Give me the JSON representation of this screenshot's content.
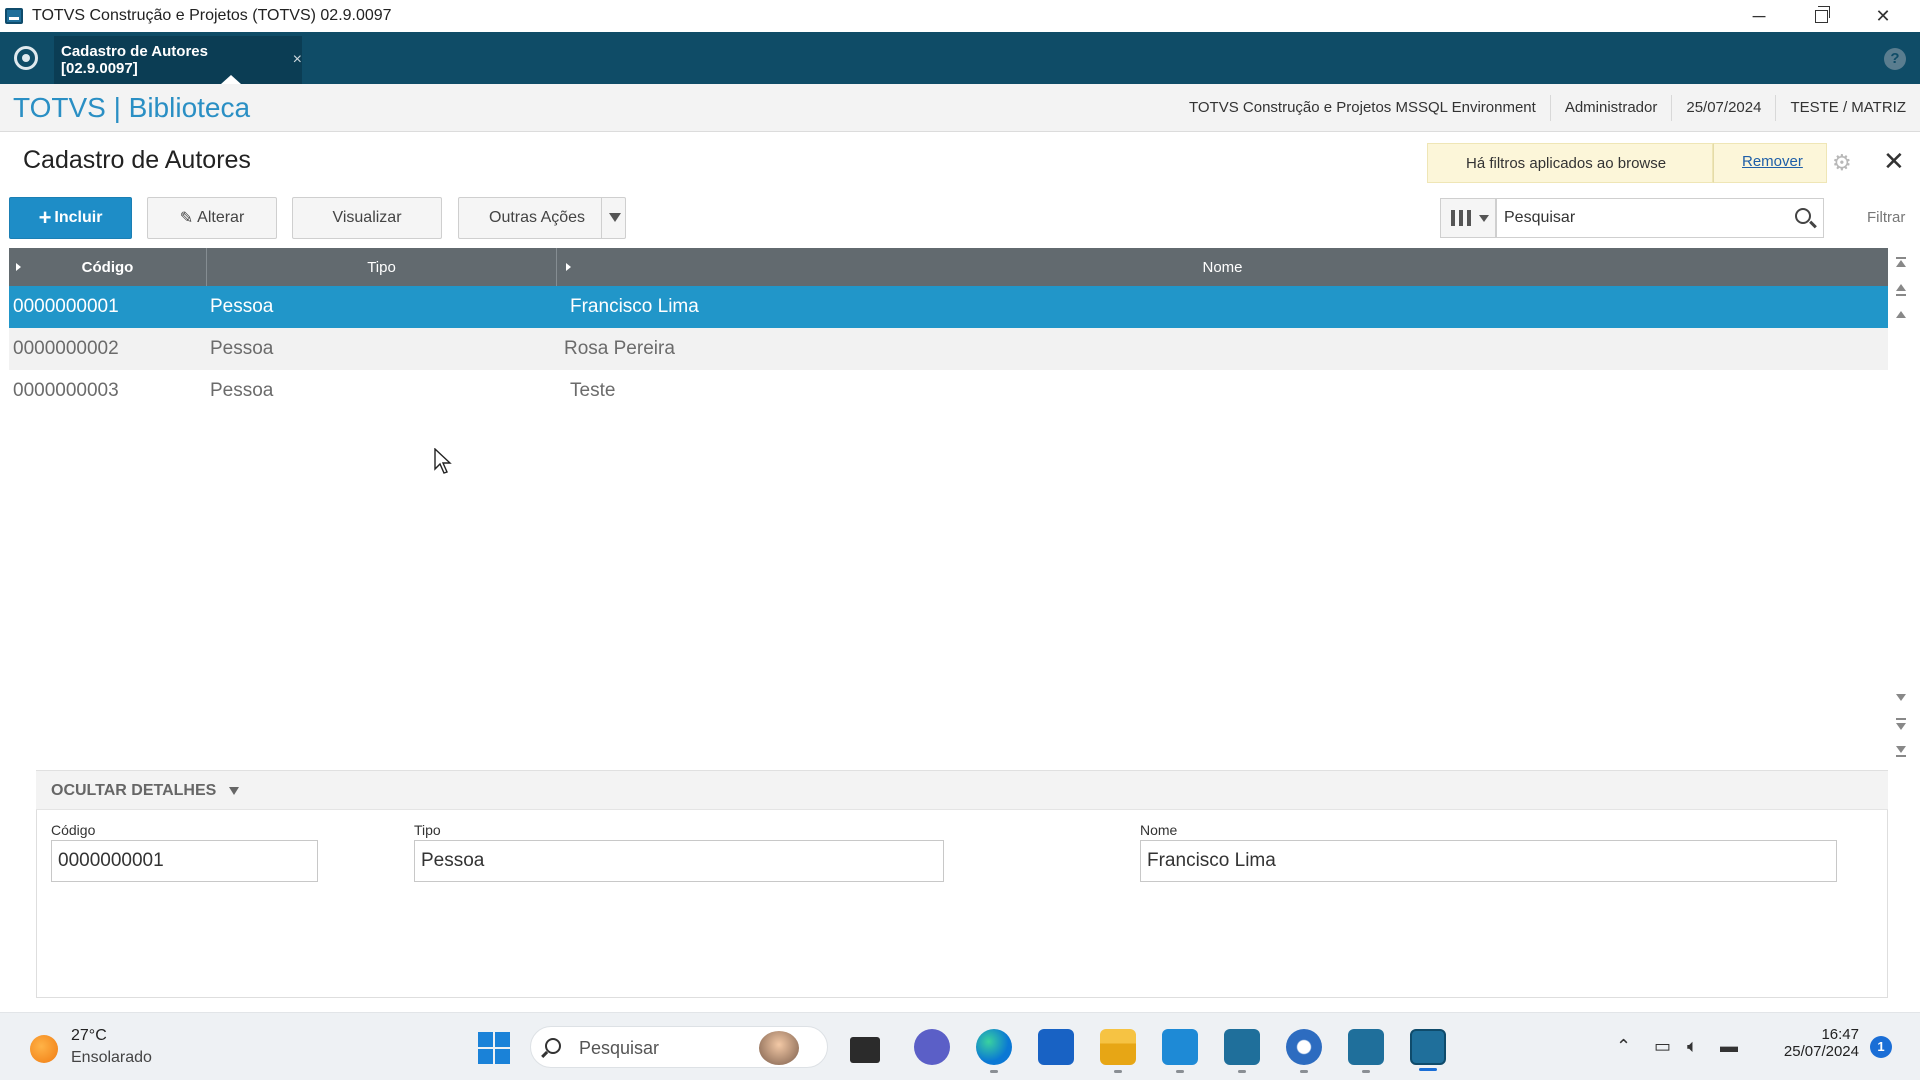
{
  "window": {
    "title": "TOTVS Construção e Projetos (TOTVS) 02.9.0097",
    "minimize": "─",
    "close": "✕"
  },
  "tabbar": {
    "active_tab": "Cadastro de Autores [02.9.0097]",
    "tab_close": "×",
    "help": "?"
  },
  "header": {
    "brand": "TOTVS | Biblioteca",
    "environment": "TOTVS Construção e Projetos MSSQL Environment",
    "user": "Administrador",
    "date": "25/07/2024",
    "company": "TESTE / MATRIZ"
  },
  "page": {
    "title": "Cadastro de Autores",
    "filter_notice": "Há filtros aplicados ao browse",
    "remove_link": "Remover",
    "close": "✕"
  },
  "toolbar": {
    "incluir": "Incluir",
    "alterar": "Alterar",
    "visualizar": "Visualizar",
    "outras_acoes": "Outras Ações",
    "search_placeholder": "Pesquisar",
    "filtrar": "Filtrar"
  },
  "grid": {
    "columns": [
      "Código",
      "Tipo",
      "Nome"
    ],
    "rows": [
      {
        "codigo": "0000000001",
        "tipo": "Pessoa",
        "nome": "Francisco Lima",
        "selected": true
      },
      {
        "codigo": "0000000002",
        "tipo": "Pessoa",
        "nome": "Rosa Pereira",
        "selected": false
      },
      {
        "codigo": "0000000003",
        "tipo": "Pessoa",
        "nome": "Teste",
        "selected": false
      }
    ]
  },
  "details": {
    "toggle_label": "OCULTAR DETALHES",
    "codigo_label": "Código",
    "codigo_value": "0000000001",
    "tipo_label": "Tipo",
    "tipo_value": "Pessoa",
    "nome_label": "Nome",
    "nome_value": "Francisco Lima"
  },
  "taskbar": {
    "weather_temp": "27°C",
    "weather_desc": "Ensolarado",
    "search_text": "Pesquisar",
    "time": "16:47",
    "date": "25/07/2024",
    "notification_count": "1"
  },
  "colors": {
    "tabbar_bg": "#0f4c67",
    "brand": "#2a8fc4",
    "primary_button": "#1e8dc7",
    "selected_row": "#2196c9",
    "grid_header": "#626a6f"
  }
}
